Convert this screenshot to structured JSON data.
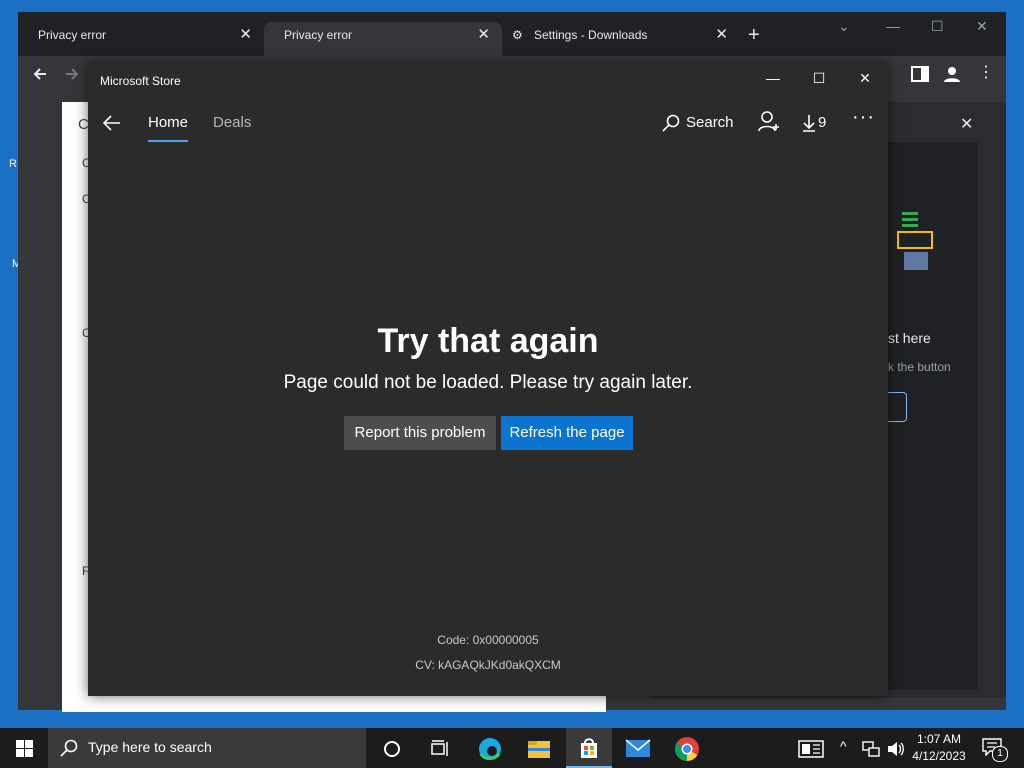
{
  "desktop": {
    "icon1_text": "R",
    "icon2_text": "M"
  },
  "chrome": {
    "tabs": [
      {
        "label": "Privacy error"
      },
      {
        "label": "Privacy error"
      },
      {
        "label": "Settings - Downloads"
      }
    ],
    "new_tab_symbol": "+",
    "page_letters": [
      "C",
      "C",
      "C",
      "C",
      "F"
    ],
    "side_panel": {
      "heading": "st here",
      "sub": "k the button"
    }
  },
  "store": {
    "title": "Microsoft Store",
    "nav": {
      "home": "Home",
      "deals": "Deals",
      "search": "Search",
      "downloads_count": "9"
    },
    "error": {
      "title": "Try that again",
      "message": "Page could not be loaded. Please try again later.",
      "report_button": "Report this problem",
      "refresh_button": "Refresh the page",
      "code": "Code: 0x00000005",
      "cv": "CV: kAGAQkJKd0akQXCM"
    }
  },
  "taskbar": {
    "search_placeholder": "Type here to search",
    "time": "1:07 AM",
    "date": "4/12/2023",
    "notification_count": "1"
  },
  "colors": {
    "accent": "#0a74d0",
    "store_bg": "#2b2b2b",
    "desktop": "#1b6fc4"
  }
}
